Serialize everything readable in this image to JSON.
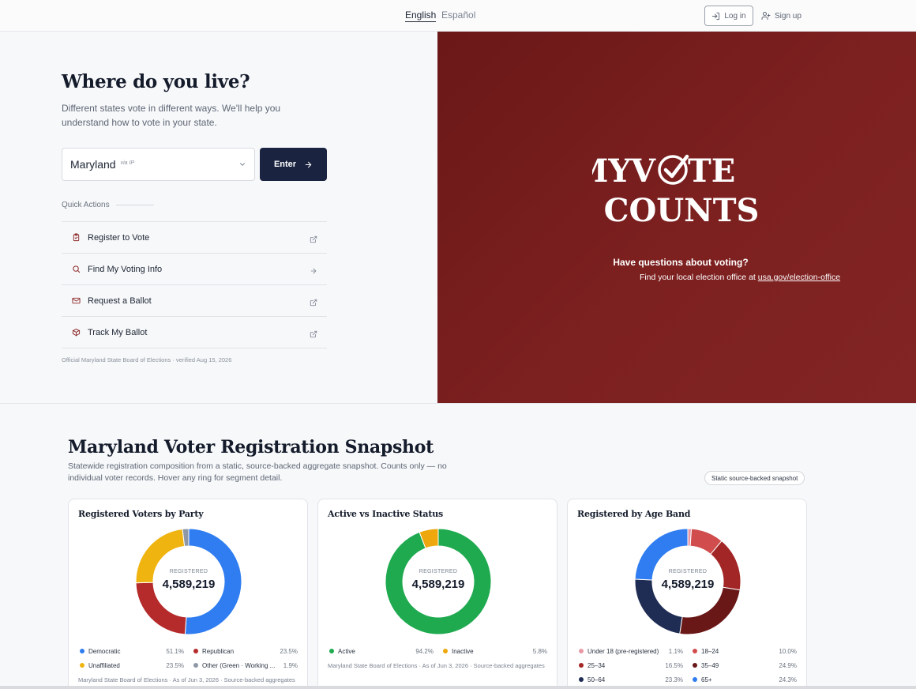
{
  "header": {
    "lang_en": "English",
    "lang_es": "Español",
    "login": "Log in",
    "signup": "Sign up"
  },
  "hero": {
    "title": "Where do you live?",
    "subtitle": "Different states vote in different ways. We'll help you understand how to vote in your state.",
    "state_value": "Maryland",
    "state_source": "via IP",
    "enter": "Enter",
    "quick_actions_label": "Quick Actions",
    "quick_actions": [
      {
        "label": "Register to Vote",
        "icon": "clipboard-check-icon",
        "trail": "external-link-icon"
      },
      {
        "label": "Find My Voting Info",
        "icon": "search-icon",
        "trail": "arrow-right-icon"
      },
      {
        "label": "Request a Ballot",
        "icon": "mail-icon",
        "trail": "external-link-icon"
      },
      {
        "label": "Track My Ballot",
        "icon": "package-icon",
        "trail": "external-link-icon"
      }
    ],
    "footnote": "Official Maryland State Board of Elections · verified Aug 15, 2026"
  },
  "promo": {
    "logo_line1_left": "MYV",
    "logo_line1_right": "TE",
    "logo_line2": "COUNTS",
    "question": "Have questions about voting?",
    "answer_prefix": "Find your local election office at ",
    "answer_link": "usa.gov/election-office"
  },
  "snapshot": {
    "title": "Maryland Voter Registration Snapshot",
    "subtitle": "Statewide registration composition from a static, source-backed aggregate snapshot. Counts only — no individual voter records. Hover any ring for segment detail.",
    "badge": "Static source-backed snapshot",
    "center_label": "REGISTERED",
    "center_value": "4,589,219"
  },
  "chart_data": [
    {
      "type": "pie",
      "title": "Registered Voters by Party",
      "center_label": "REGISTERED",
      "center_value": "4,589,219",
      "categories": [
        "Democratic",
        "Republican",
        "Unaffiliated",
        "Other (Green · Working ..."
      ],
      "values": [
        51.1,
        23.5,
        23.5,
        1.9
      ],
      "labels": [
        "51.1%",
        "23.5%",
        "23.5%",
        "1.9%"
      ],
      "colors": [
        "#2f7df0",
        "#b52a2a",
        "#efb40f",
        "#8e97a6"
      ],
      "footnote": "Maryland State Board of Elections · As of Jun 3, 2026 · Source-backed aggregates"
    },
    {
      "type": "pie",
      "title": "Active vs Inactive Status",
      "center_label": "REGISTERED",
      "center_value": "4,589,219",
      "categories": [
        "Active",
        "Inactive"
      ],
      "values": [
        94.2,
        5.8
      ],
      "labels": [
        "94.2%",
        "5.8%"
      ],
      "colors": [
        "#1faa4f",
        "#efa70e"
      ],
      "footnote": "Maryland State Board of Elections · As of Jun 3, 2026 · Source-backed aggregates"
    },
    {
      "type": "pie",
      "title": "Registered by Age Band",
      "center_label": "REGISTERED",
      "center_value": "4,589,219",
      "categories": [
        "Under 18 (pre-registered)",
        "18–24",
        "25–34",
        "35–49",
        "50–64",
        "65+"
      ],
      "values": [
        1.1,
        10.0,
        16.5,
        24.9,
        23.3,
        24.3
      ],
      "labels": [
        "1.1%",
        "10.0%",
        "16.5%",
        "24.9%",
        "23.3%",
        "24.3%"
      ],
      "colors": [
        "#e79aa6",
        "#d14c4c",
        "#a32626",
        "#6a1717",
        "#1f2c53",
        "#2f7df0"
      ],
      "footnote": ""
    }
  ]
}
